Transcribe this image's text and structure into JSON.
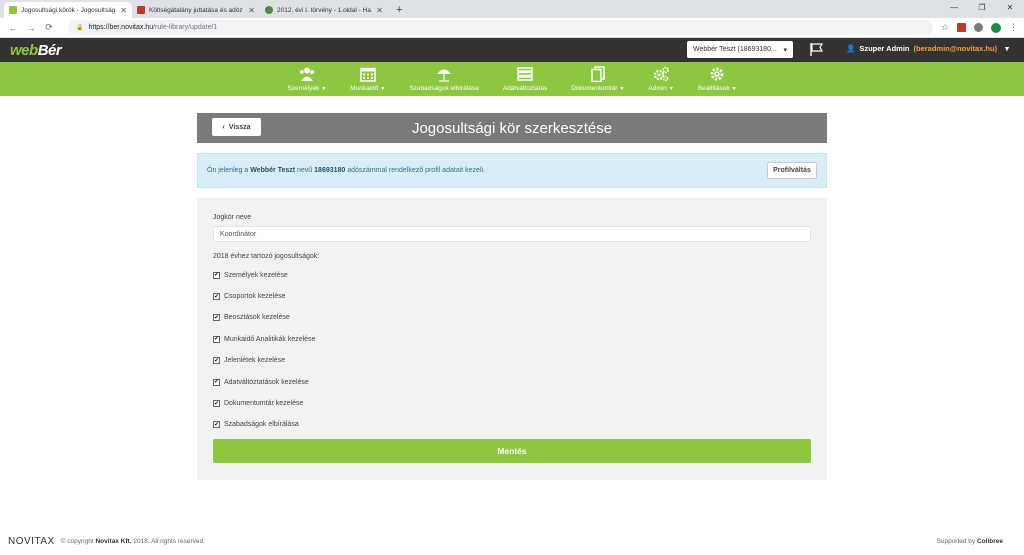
{
  "browser": {
    "tabs": [
      {
        "title": "Jogosultsági körök - Jogosultság",
        "color": "#8dc63f",
        "active": true
      },
      {
        "title": "Költségátalány juttatása és adóz",
        "color": "#c0392b",
        "active": false
      },
      {
        "title": "2012. évi I. törvény - 1.oldal - Ha",
        "color": "#4a8f3a",
        "active": false
      }
    ],
    "url_host": "https://ber.novitax.hu",
    "url_path": "/rule-library/update/1"
  },
  "app": {
    "logo_a": "web",
    "logo_b": "Bér",
    "account_select": "Webbér Teszt (18693180...",
    "user_name": "Szuper Admin",
    "user_email": "(beradmin@novitax.hu)"
  },
  "nav": [
    {
      "label": "Személyek",
      "caret": true,
      "icon": "users-icon"
    },
    {
      "label": "Munkaidő",
      "caret": true,
      "icon": "calendar-icon"
    },
    {
      "label": "Szabadságok elbírálása",
      "caret": false,
      "icon": "umbrella-icon"
    },
    {
      "label": "Adatváltoztatás",
      "caret": false,
      "icon": "list-icon"
    },
    {
      "label": "Dokumentumtár",
      "caret": true,
      "icon": "documents-icon"
    },
    {
      "label": "Admin",
      "caret": true,
      "icon": "gears-icon"
    },
    {
      "label": "Beállítások",
      "caret": true,
      "icon": "gear-icon"
    }
  ],
  "page": {
    "back": "Vissza",
    "title": "Jogosultsági kör szerkesztése",
    "info_pre": "Ön jelenleg a ",
    "info_company": "Webbér Teszt",
    "info_mid": " nevű ",
    "info_tax": "18693180",
    "info_post": " adószámmal rendelkező profil adatait kezeli.",
    "profile_button": "Profilváltás",
    "field_label": "Jogkör neve",
    "field_value": "Koordinátor",
    "perm_title": "2018 évhez tartozó jogosultságok:",
    "permissions": [
      {
        "label": "Személyek kezelése",
        "checked": true
      },
      {
        "label": "Csoportok kezelése",
        "checked": true
      },
      {
        "label": "Beosztások kezelése",
        "checked": true
      },
      {
        "label": "Munkaidő Analitikák kezelése",
        "checked": true
      },
      {
        "label": "Jelenlétek kezelése",
        "checked": true
      },
      {
        "label": "Adatváltoztatások kezelése",
        "checked": true
      },
      {
        "label": "Dokumentumtár kezelése",
        "checked": true
      },
      {
        "label": "Szabadságok elbírálása",
        "checked": true
      }
    ],
    "save": "Mentés"
  },
  "footer": {
    "logo": "NOVITAX",
    "copyright_pre": "© copyright ",
    "copyright_company": "Novitax Kft.",
    "copyright_post": " 2018. All rights reserved.",
    "supported_pre": "Supported by ",
    "supported_by": "Colibree"
  },
  "colors": {
    "brand_green": "#8dc63f",
    "topbar": "#333333",
    "header_grey": "#7a7a7a",
    "info_bg": "#d9edf7"
  }
}
